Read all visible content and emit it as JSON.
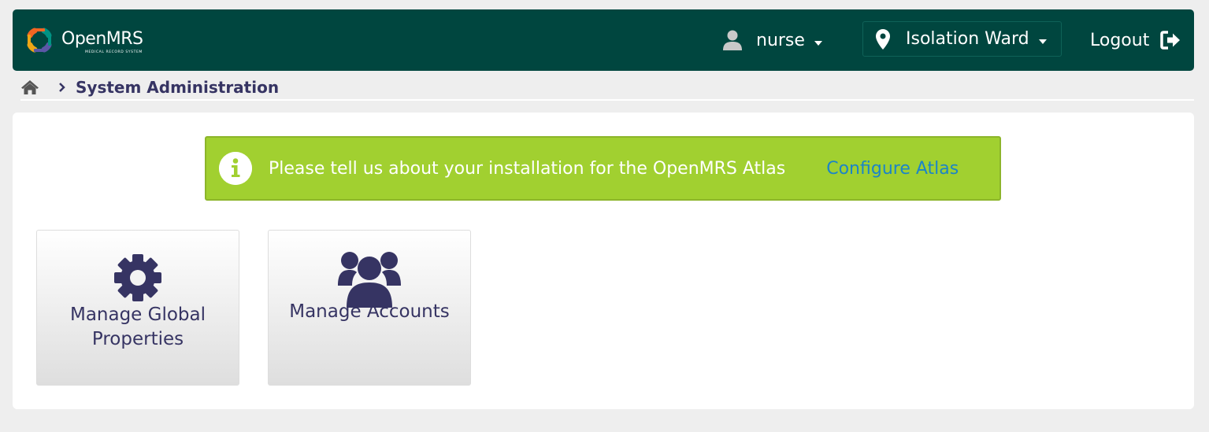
{
  "header": {
    "logo_text": "OpenMRS",
    "logo_subtext": "MEDICAL RECORD SYSTEM",
    "user": {
      "name": "nurse",
      "icon": "user-icon"
    },
    "location": {
      "name": "Isolation Ward",
      "icon": "map-marker-icon"
    },
    "logout": {
      "label": "Logout",
      "icon": "sign-out-icon"
    }
  },
  "breadcrumb": {
    "home_icon": "home-icon",
    "current": "System Administration"
  },
  "alert": {
    "message": "Please tell us about your installation for the OpenMRS Atlas",
    "link": "Configure Atlas",
    "icon": "info-icon"
  },
  "apps": [
    {
      "label": "Manage Global Properties",
      "icon": "gear-icon"
    },
    {
      "label": "Manage Accounts",
      "icon": "users-icon"
    }
  ],
  "colors": {
    "header_bg": "#00463f",
    "accent_text": "#363463",
    "alert_bg": "#a1d030",
    "link": "#1b84c8"
  }
}
